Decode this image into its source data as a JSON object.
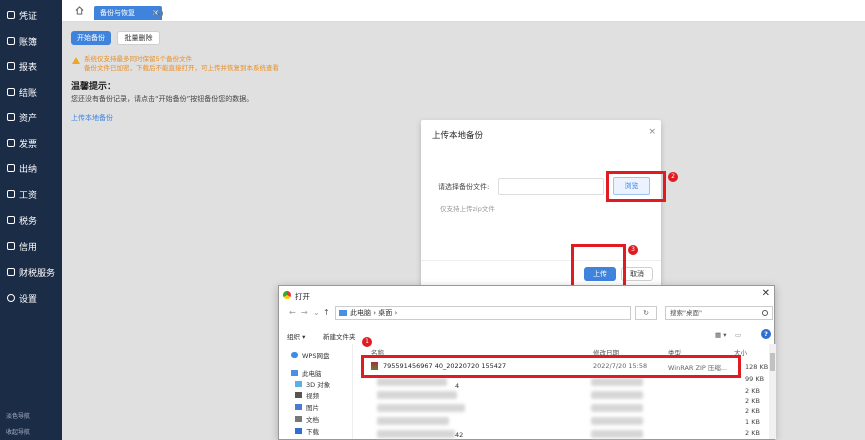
{
  "sidebar": {
    "items": [
      {
        "label": "凭证",
        "icon": "voucher-icon"
      },
      {
        "label": "账簿",
        "icon": "ledger-icon"
      },
      {
        "label": "报表",
        "icon": "report-icon"
      },
      {
        "label": "结账",
        "icon": "closing-icon"
      },
      {
        "label": "资产",
        "icon": "asset-icon"
      },
      {
        "label": "发票",
        "icon": "invoice-icon"
      },
      {
        "label": "出纳",
        "icon": "cashier-icon"
      },
      {
        "label": "工资",
        "icon": "salary-icon"
      },
      {
        "label": "税务",
        "icon": "tax-icon"
      },
      {
        "label": "信用",
        "icon": "credit-icon"
      },
      {
        "label": "财税服务",
        "icon": "tax-service-icon"
      },
      {
        "label": "设置",
        "icon": "settings-icon"
      }
    ],
    "footer": [
      "淡色导航",
      "收起导航"
    ]
  },
  "tabs": {
    "active": "备份与恢复"
  },
  "toolbar": {
    "start_backup": "开始备份",
    "batch_delete": "批量删除"
  },
  "warning": {
    "line1": "系统仅支持最多同时保留5个备份文件",
    "line2": "备份文件已加密，下载后不能直接打开，可上传并恢复到本系统查看"
  },
  "tips": {
    "title": "温馨提示：",
    "text": "您还没有备份记录，请点击“开始备份”按钮备份您的数据。",
    "upload_link": "上传本地备份"
  },
  "dialog": {
    "title": "上传本地备份",
    "file_label": "请选择备份文件:",
    "browse": "浏览",
    "hint": "仅支持上传zip文件",
    "upload": "上传",
    "cancel": "取消"
  },
  "markers": [
    "1",
    "2",
    "3"
  ],
  "explorer": {
    "title": "打开",
    "path": [
      "此电脑",
      "桌面"
    ],
    "search_placeholder": "搜索\"桌面\"",
    "organize": "组织 ▾",
    "new_folder": "新建文件夹",
    "left_pane": [
      {
        "label": "WPS网盘",
        "icon": "cloud-icon",
        "color": "#3a8ee6"
      },
      {
        "label": "此电脑",
        "icon": "computer-icon",
        "color": "#4a90e2"
      },
      {
        "label": "3D 对象",
        "icon": "3d-icon",
        "color": "#5bb0e6"
      },
      {
        "label": "视频",
        "icon": "video-icon",
        "color": "#555555"
      },
      {
        "label": "图片",
        "icon": "picture-icon",
        "color": "#4a7bd0"
      },
      {
        "label": "文档",
        "icon": "document-icon",
        "color": "#777777"
      },
      {
        "label": "下载",
        "icon": "download-icon",
        "color": "#2f6fd1"
      }
    ],
    "columns": [
      "名称",
      "修改日期",
      "类型",
      "大小"
    ],
    "selected_file": {
      "name": "795591456967 40_20220720 155427",
      "date": "2022/7/20 15:58",
      "type": "WinRAR ZIP 压缩..."
    },
    "sizes": [
      "128 KB",
      "99 KB",
      "2 KB",
      "2 KB",
      "2 KB",
      "1 KB",
      "2 KB"
    ],
    "partial_rows": [
      "4",
      "42"
    ]
  }
}
